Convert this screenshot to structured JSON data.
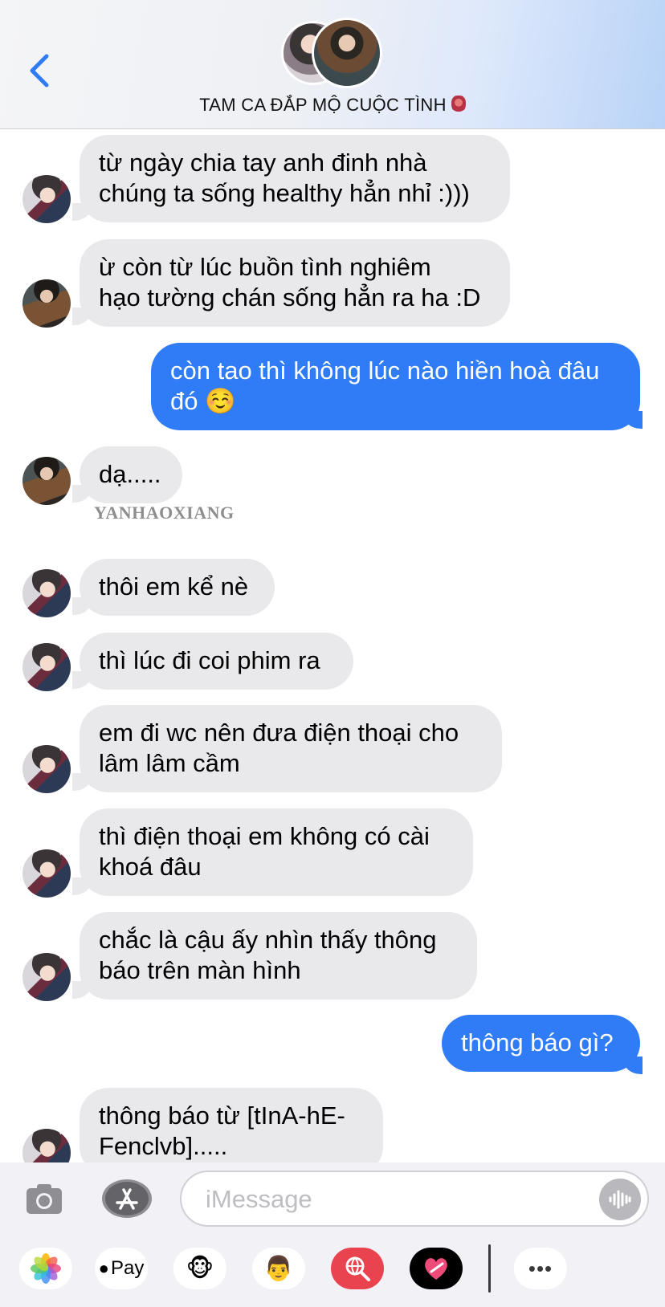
{
  "header": {
    "title": "TAM CA ĐẮP MỘ CUỘC TÌNH"
  },
  "messages": [
    {
      "dir": "in",
      "text": "từ ngày chia tay anh đinh nhà\nchúng ta sống healthy hẳn nhỉ :)))"
    },
    {
      "dir": "in",
      "text": "ừ còn từ lúc buồn tình nghiêm\nhạo tường chán sống hẳn ra ha :D"
    },
    {
      "dir": "out",
      "text": "còn tao thì không lúc nào hiền hoà đâu\nđó ☺️"
    },
    {
      "dir": "in",
      "text": "dạ....."
    },
    {
      "dir": "in",
      "text": "thôi em kể nè"
    },
    {
      "dir": "in",
      "text": "thì lúc đi coi phim ra"
    },
    {
      "dir": "in",
      "text": "em đi wc nên đưa điện thoại cho\nlâm lâm cầm"
    },
    {
      "dir": "in",
      "text": "thì điện thoại em không có cài\nkhoá đâu"
    },
    {
      "dir": "in",
      "text": "chắc là cậu ấy nhìn thấy thông\nbáo trên màn hình"
    },
    {
      "dir": "out",
      "text": "thông báo gì?"
    },
    {
      "dir": "in",
      "text": "thông báo từ [tInA-hE-\nFenclvb]....."
    }
  ],
  "watermark": "YANHAOXIANG",
  "compose": {
    "placeholder": "iMessage",
    "apps": [
      {
        "name": "photos-app",
        "label": ""
      },
      {
        "name": "apple-pay-app",
        "label": "Pay"
      },
      {
        "name": "animoji-app",
        "label": "🐵"
      },
      {
        "name": "memoji-app",
        "label": "👨"
      },
      {
        "name": "images-search-app",
        "label": ""
      },
      {
        "name": "digital-touch-app",
        "label": ""
      },
      {
        "name": "more-apps",
        "label": "•••"
      }
    ]
  },
  "colors": {
    "incoming_bubble": "#e9e9eb",
    "outgoing_bubble": "#2f7cf6",
    "accent": "#2f7cf6"
  }
}
